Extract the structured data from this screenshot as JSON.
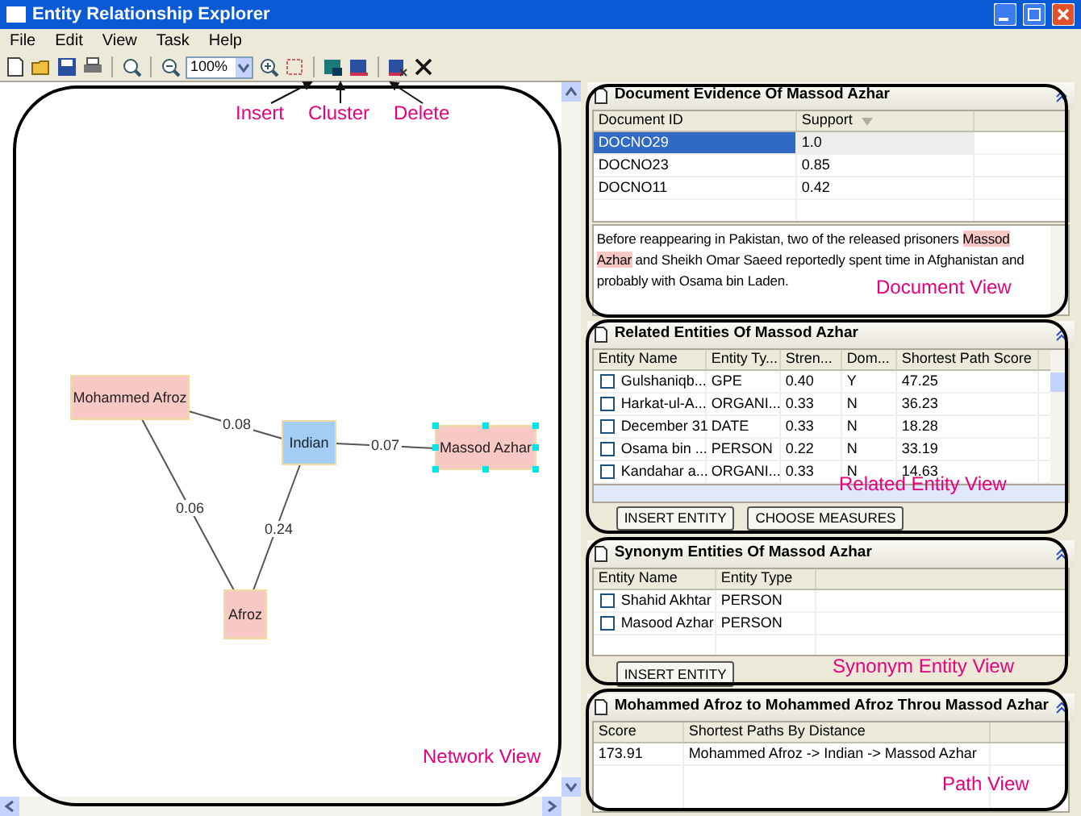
{
  "window": {
    "title": "Entity Relationship Explorer"
  },
  "menu": [
    "File",
    "Edit",
    "View",
    "Task",
    "Help"
  ],
  "toolbar": {
    "zoom": "100%"
  },
  "network": {
    "nodes": [
      {
        "label": "Mohammed Afroz",
        "color": "#f8c8c4",
        "selected": false
      },
      {
        "label": "Indian",
        "color": "#a3cdf5",
        "selected": false
      },
      {
        "label": "Massod Azhar",
        "color": "#f8c8c4",
        "selected": true
      },
      {
        "label": "Afroz",
        "color": "#f8c8c4",
        "selected": false
      }
    ],
    "edges": [
      {
        "label": "0.08"
      },
      {
        "label": "0.07"
      },
      {
        "label": "0.06"
      },
      {
        "label": "0.24"
      }
    ]
  },
  "document_view": {
    "title": "Document Evidence Of Massod Azhar",
    "columns": [
      "Document ID",
      "Support"
    ],
    "rows": [
      {
        "cells": [
          "DOCNO29",
          "1.0"
        ],
        "selected": true
      },
      {
        "cells": [
          "DOCNO23",
          "0.85"
        ],
        "selected": false
      },
      {
        "cells": [
          "DOCNO11",
          "0.42"
        ],
        "selected": false
      }
    ],
    "excerpt": [
      {
        "text": "Before reappearing in Pakistan, two of the released prisoners ",
        "highlighted": false
      },
      {
        "text": "Massod Azhar",
        "highlighted": true
      },
      {
        "text": " and  Sheikh Omar Saeed reportedly spent time in Afghanistan and probably with Osama bin Laden.",
        "highlighted": false
      }
    ]
  },
  "related_view": {
    "title": "Related Entities Of Massod Azhar",
    "columns": [
      "Entity Name",
      "Entity Ty...",
      "Stren...",
      "Dom...",
      "Shortest Path Score"
    ],
    "rows": [
      {
        "checked": false,
        "cells": [
          "Gulshaniqb...",
          "GPE",
          "0.40",
          "Y",
          "47.25"
        ]
      },
      {
        "checked": false,
        "cells": [
          "Harkat-ul-A...",
          "ORGANI...",
          "0.33",
          "N",
          "36.23"
        ]
      },
      {
        "checked": false,
        "cells": [
          "December 31",
          "DATE",
          "0.33",
          "N",
          "18.28"
        ]
      },
      {
        "checked": false,
        "cells": [
          "Osama bin ...",
          "PERSON",
          "0.22",
          "N",
          "33.19"
        ]
      },
      {
        "checked": false,
        "cells": [
          "Kandahar a...",
          "ORGANI...",
          "0.33",
          "N",
          "14.63"
        ]
      }
    ],
    "buttons": [
      "INSERT ENTITY",
      "CHOOSE MEASURES"
    ]
  },
  "synonym_view": {
    "title": "Synonym Entities Of Massod Azhar",
    "columns": [
      "Entity Name",
      "Entity Type"
    ],
    "rows": [
      {
        "checked": false,
        "cells": [
          "Shahid Akhtar",
          "PERSON"
        ]
      },
      {
        "checked": false,
        "cells": [
          "Masood Azhar",
          "PERSON"
        ]
      }
    ],
    "buttons": [
      "INSERT ENTITY"
    ]
  },
  "path_view": {
    "title": "Mohammed Afroz to Mohammed Afroz Throu Massod Azhar",
    "columns": [
      "Score",
      "Shortest Paths By Distance"
    ],
    "rows": [
      {
        "cells": [
          "173.91",
          "Mohammed Afroz -> Indian -> Massod Azhar"
        ]
      }
    ]
  },
  "annotations": {
    "callouts": [
      {
        "text": "Insert"
      },
      {
        "text": "Cluster"
      },
      {
        "text": "Delete"
      }
    ],
    "view_labels": [
      "Network View",
      "Document View",
      "Related Entity View",
      "Synonym Entity View",
      "Path View"
    ]
  }
}
